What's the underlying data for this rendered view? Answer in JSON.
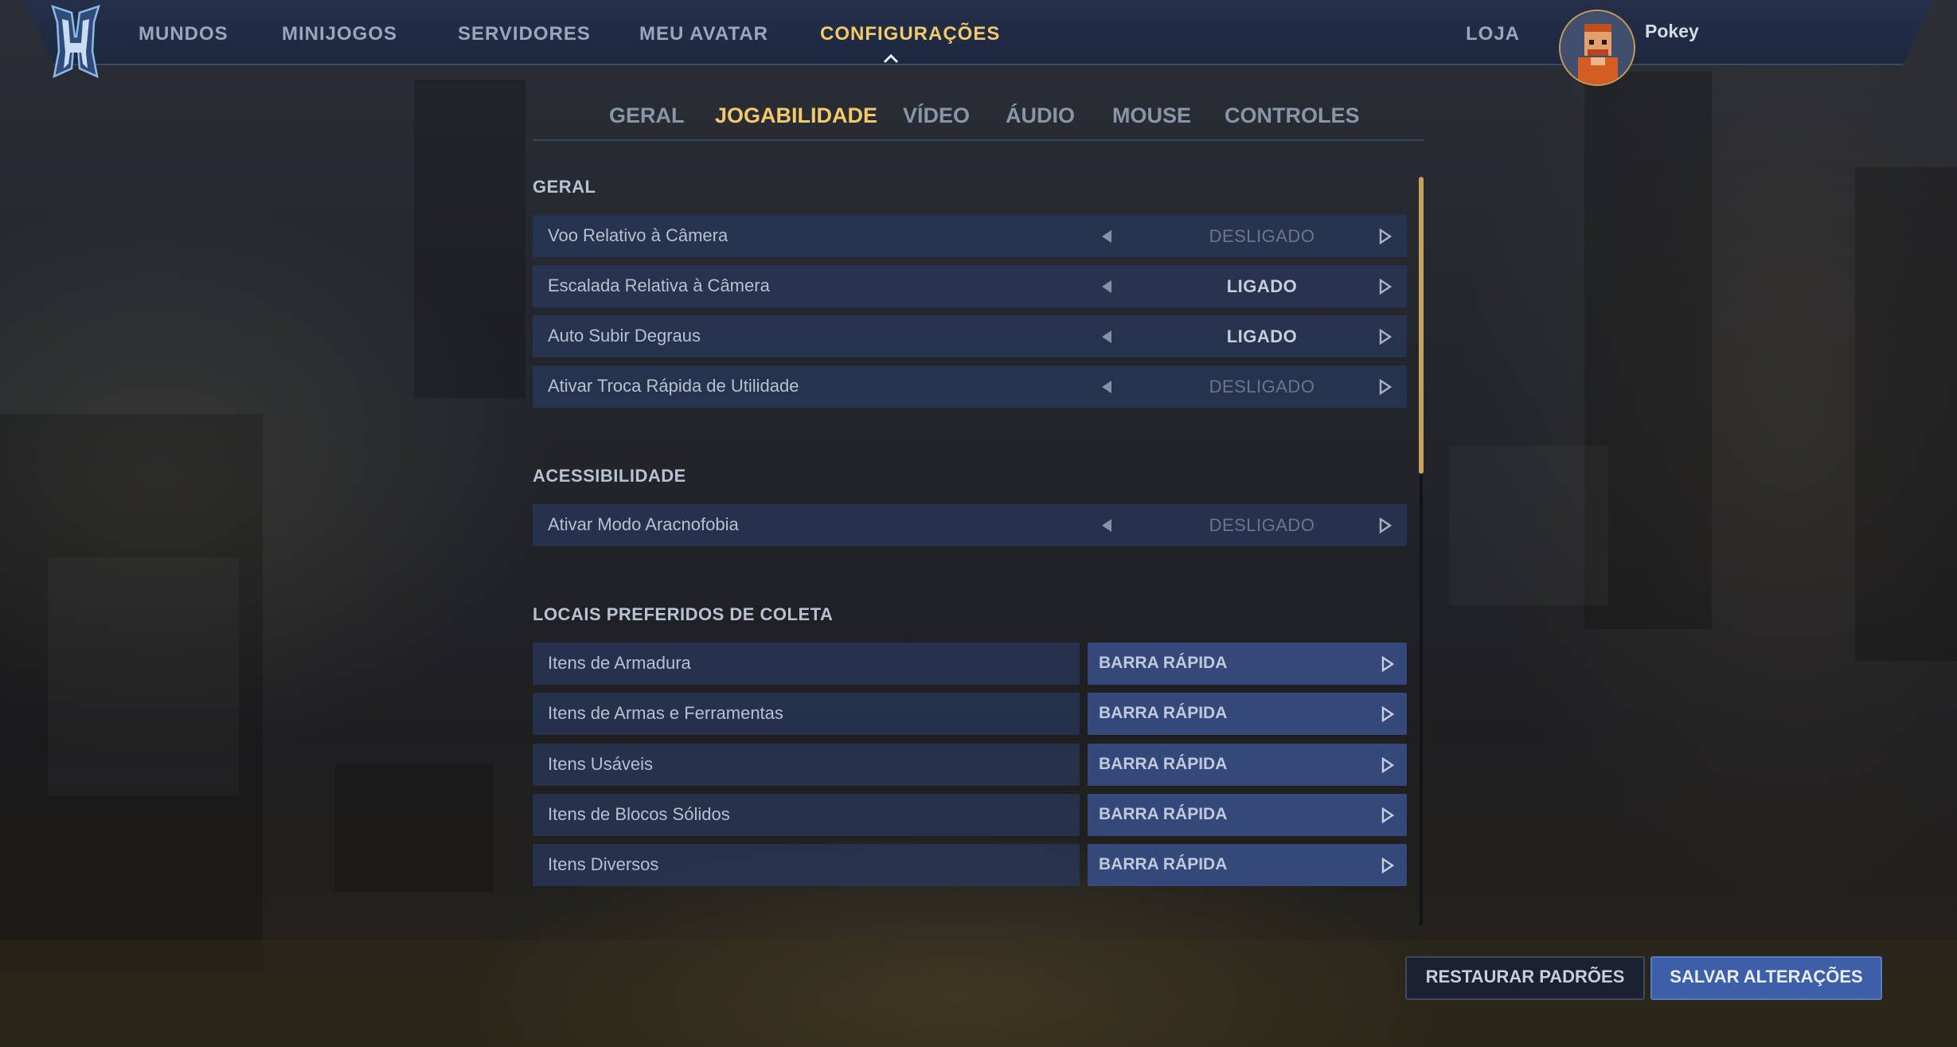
{
  "nav": {
    "items": [
      {
        "label": "MUNDOS"
      },
      {
        "label": "MINIJOGOS"
      },
      {
        "label": "SERVIDORES"
      },
      {
        "label": "MEU AVATAR"
      },
      {
        "label": "CONFIGURAÇÕES",
        "active": true
      }
    ],
    "shop": "LOJA",
    "username": "Pokey",
    "logo_icon": "hytale-h-logo",
    "accent_color": "#f3c96b"
  },
  "tabs": [
    {
      "label": "GERAL"
    },
    {
      "label": "JOGABILIDADE",
      "active": true
    },
    {
      "label": "VÍDEO"
    },
    {
      "label": "ÁUDIO"
    },
    {
      "label": "MOUSE"
    },
    {
      "label": "CONTROLES"
    }
  ],
  "sections": {
    "geral": {
      "title": "GERAL",
      "rows": [
        {
          "label": "Voo Relativo à Câmera",
          "value": "DESLIGADO"
        },
        {
          "label": "Escalada Relativa à Câmera",
          "value": "LIGADO"
        },
        {
          "label": "Auto Subir Degraus",
          "value": "LIGADO"
        },
        {
          "label": "Ativar Troca Rápida de Utilidade",
          "value": "DESLIGADO"
        }
      ]
    },
    "acessibilidade": {
      "title": "ACESSIBILIDADE",
      "rows": [
        {
          "label": "Ativar Modo Aracnofobia",
          "value": "DESLIGADO"
        }
      ]
    },
    "coleta": {
      "title": "LOCAIS PREFERIDOS DE COLETA",
      "rows": [
        {
          "label": "Itens de Armadura",
          "value": "BARRA RÁPIDA"
        },
        {
          "label": "Itens de Armas e Ferramentas",
          "value": "BARRA RÁPIDA"
        },
        {
          "label": "Itens Usáveis",
          "value": "BARRA RÁPIDA"
        },
        {
          "label": "Itens de Blocos Sólidos",
          "value": "BARRA RÁPIDA"
        },
        {
          "label": "Itens Diversos",
          "value": "BARRA RÁPIDA"
        }
      ]
    }
  },
  "buttons": {
    "restore": "RESTAURAR PADRÕES",
    "save": "SALVAR ALTERAÇÕES"
  }
}
